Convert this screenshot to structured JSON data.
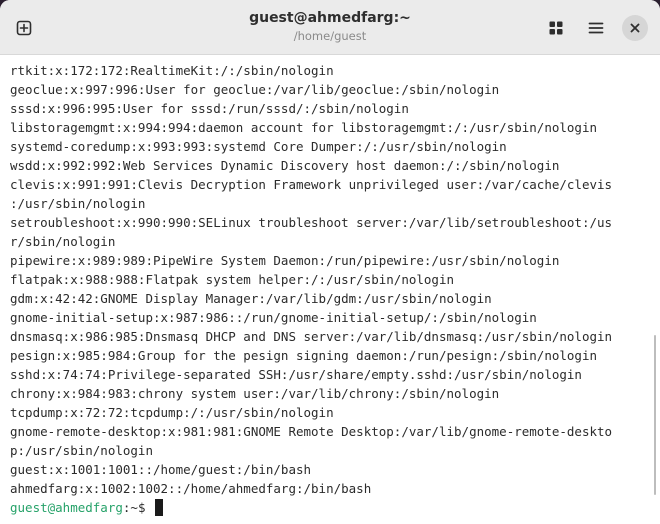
{
  "window": {
    "title": "guest@ahmedfarg:~",
    "subtitle": "/home/guest"
  },
  "header": {
    "icons": [
      "new-tab-icon",
      "tabs-overview-icon",
      "hamburger-menu-icon",
      "close-icon"
    ]
  },
  "terminal": {
    "lines": [
      "rtkit:x:172:172:RealtimeKit:/:/sbin/nologin",
      "geoclue:x:997:996:User for geoclue:/var/lib/geoclue:/sbin/nologin",
      "sssd:x:996:995:User for sssd:/run/sssd/:/sbin/nologin",
      "libstoragemgmt:x:994:994:daemon account for libstoragemgmt:/:/usr/sbin/nologin",
      "systemd-coredump:x:993:993:systemd Core Dumper:/:/usr/sbin/nologin",
      "wsdd:x:992:992:Web Services Dynamic Discovery host daemon:/:/sbin/nologin",
      "clevis:x:991:991:Clevis Decryption Framework unprivileged user:/var/cache/clevis",
      ":/usr/sbin/nologin",
      "setroubleshoot:x:990:990:SELinux troubleshoot server:/var/lib/setroubleshoot:/us",
      "r/sbin/nologin",
      "pipewire:x:989:989:PipeWire System Daemon:/run/pipewire:/usr/sbin/nologin",
      "flatpak:x:988:988:Flatpak system helper:/:/usr/sbin/nologin",
      "gdm:x:42:42:GNOME Display Manager:/var/lib/gdm:/usr/sbin/nologin",
      "gnome-initial-setup:x:987:986::/run/gnome-initial-setup/:/sbin/nologin",
      "dnsmasq:x:986:985:Dnsmasq DHCP and DNS server:/var/lib/dnsmasq:/usr/sbin/nologin",
      "pesign:x:985:984:Group for the pesign signing daemon:/run/pesign:/sbin/nologin",
      "sshd:x:74:74:Privilege-separated SSH:/usr/share/empty.sshd:/usr/sbin/nologin",
      "chrony:x:984:983:chrony system user:/var/lib/chrony:/sbin/nologin",
      "tcpdump:x:72:72:tcpdump:/:/usr/sbin/nologin",
      "gnome-remote-desktop:x:981:981:GNOME Remote Desktop:/var/lib/gnome-remote-deskto",
      "p:/usr/sbin/nologin",
      "guest:x:1001:1001::/home/guest:/bin/bash",
      "ahmedfarg:x:1002:1002::/home/ahmedfarg:/bin/bash"
    ],
    "prompt_user": "guest@ahmedfarg",
    "prompt_sym": ":~$ ",
    "colors": {
      "prompt": "#26a269",
      "text": "#2b2b2b",
      "background": "#ffffff"
    }
  }
}
